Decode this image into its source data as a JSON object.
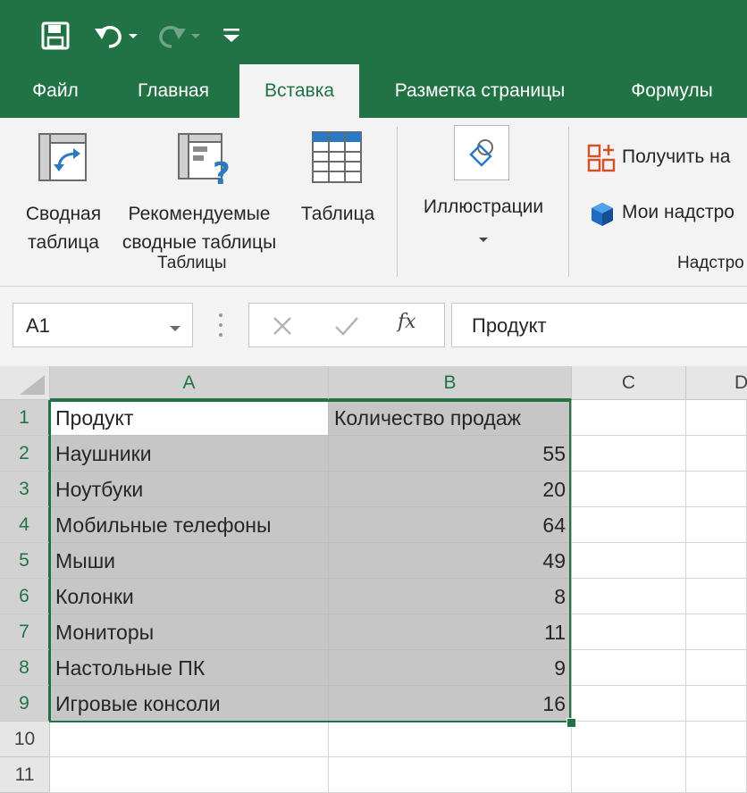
{
  "tabs": [
    {
      "label": "Файл",
      "active": false
    },
    {
      "label": "Главная",
      "active": false
    },
    {
      "label": "Вставка",
      "active": true
    },
    {
      "label": "Разметка страницы",
      "active": false
    },
    {
      "label": "Формулы",
      "active": false
    }
  ],
  "ribbon": {
    "pivot_table": {
      "line1": "Сводная",
      "line2": "таблица"
    },
    "recommended_pivot": {
      "line1": "Рекомендуемые",
      "line2": "сводные таблицы"
    },
    "table": {
      "label": "Таблица"
    },
    "illustrations": {
      "label": "Иллюстрации"
    },
    "get_addins": {
      "label": "Получить на"
    },
    "my_addins": {
      "label": "Мои надстро"
    },
    "group_tables": "Таблицы",
    "group_addins": "Надстро"
  },
  "formula_bar": {
    "name_box": "A1",
    "fx_symbol": "fx",
    "formula": "Продукт"
  },
  "columns": [
    "A",
    "B",
    "C",
    "D"
  ],
  "rows": [
    {
      "num": "1",
      "a": "Продукт",
      "b": "Количество продаж"
    },
    {
      "num": "2",
      "a": "Наушники",
      "b": "55"
    },
    {
      "num": "3",
      "a": "Ноутбуки",
      "b": "20"
    },
    {
      "num": "4",
      "a": "Мобильные телефоны",
      "b": "64"
    },
    {
      "num": "5",
      "a": "Мыши",
      "b": "49"
    },
    {
      "num": "6",
      "a": "Колонки",
      "b": "8"
    },
    {
      "num": "7",
      "a": "Мониторы",
      "b": "11"
    },
    {
      "num": "8",
      "a": "Настольные ПК",
      "b": "9"
    },
    {
      "num": "9",
      "a": "Игровые консоли",
      "b": "16"
    },
    {
      "num": "10",
      "a": "",
      "b": ""
    },
    {
      "num": "11",
      "a": "",
      "b": ""
    }
  ],
  "colors": {
    "accent": "#217346",
    "selection": "#c6c6c6",
    "ribbon_bg": "#f3f3f3"
  }
}
